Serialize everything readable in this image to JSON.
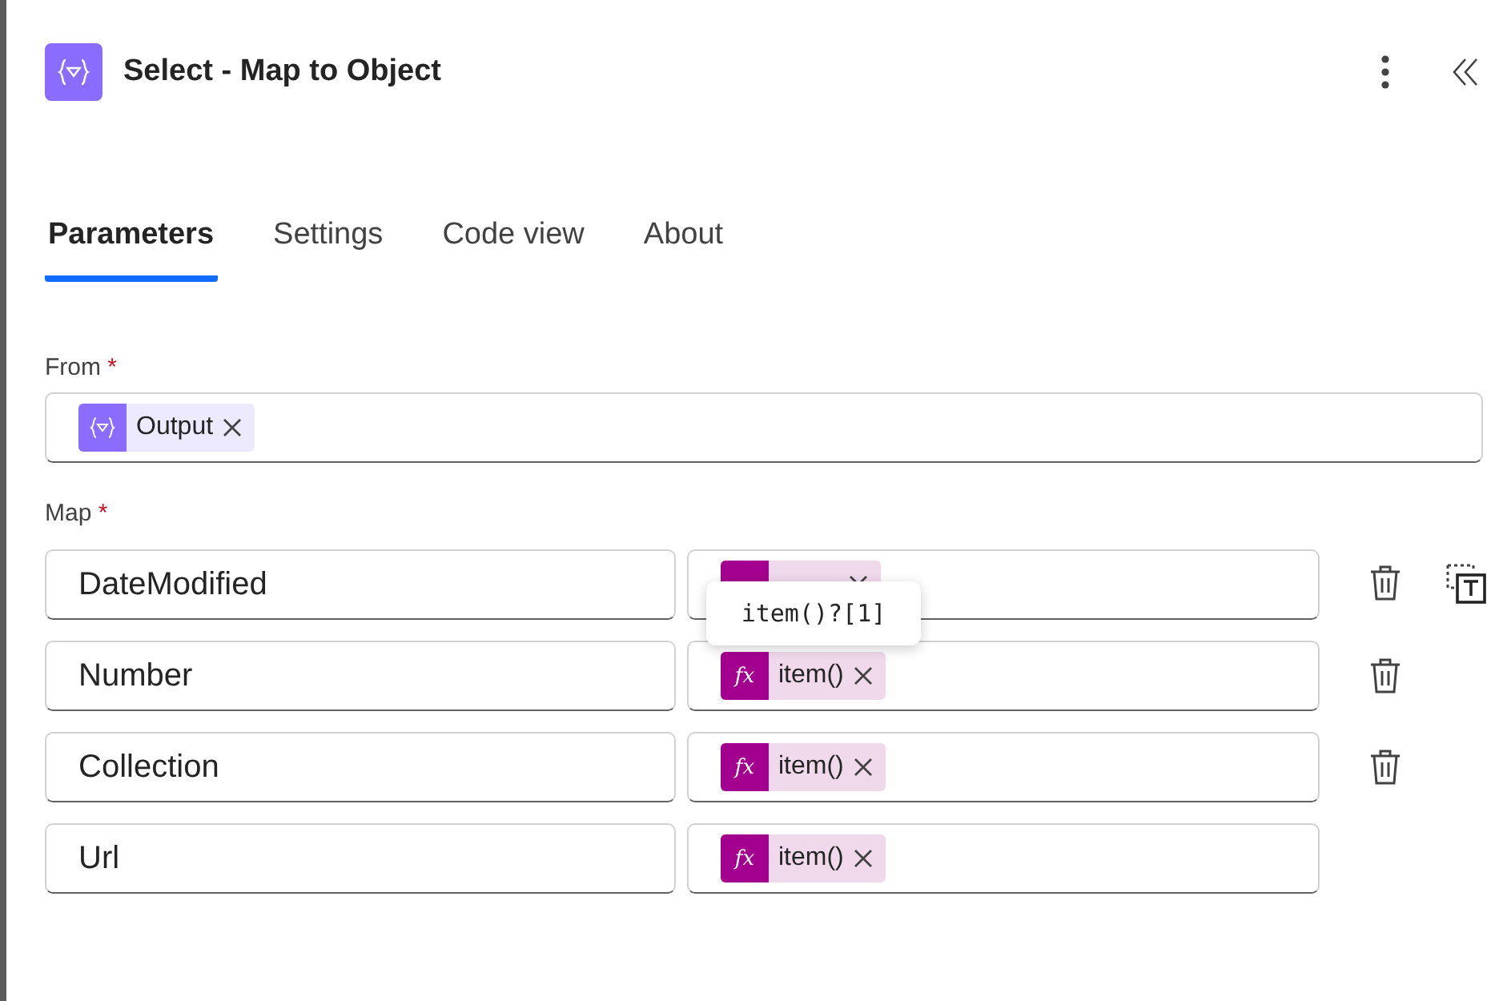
{
  "header": {
    "title": "Select - Map to Object"
  },
  "tabs": [
    {
      "label": "Parameters",
      "selected": true
    },
    {
      "label": "Settings",
      "selected": false
    },
    {
      "label": "Code view",
      "selected": false
    },
    {
      "label": "About",
      "selected": false
    }
  ],
  "from": {
    "label": "From",
    "required_mark": "*",
    "tokens": [
      {
        "kind": "variable",
        "text": "Output"
      }
    ]
  },
  "map": {
    "label": "Map",
    "required_mark": "*",
    "rows": [
      {
        "key": "DateModified",
        "value": {
          "kind": "expression"
        },
        "deletable": true,
        "text_mode_toggle": true
      },
      {
        "key": "Number",
        "value": {
          "kind": "expression",
          "icon_text": "fx",
          "text": "item()"
        },
        "deletable": true,
        "text_mode_toggle": false
      },
      {
        "key": "Collection",
        "value": {
          "kind": "expression",
          "icon_text": "fx",
          "text": "item()"
        },
        "deletable": true,
        "text_mode_toggle": false
      },
      {
        "key": "Url",
        "value": {
          "kind": "expression",
          "icon_text": "fx",
          "text": "item()"
        },
        "deletable": false,
        "text_mode_toggle": false
      }
    ]
  },
  "tooltip": {
    "text": "item()?[1]"
  }
}
